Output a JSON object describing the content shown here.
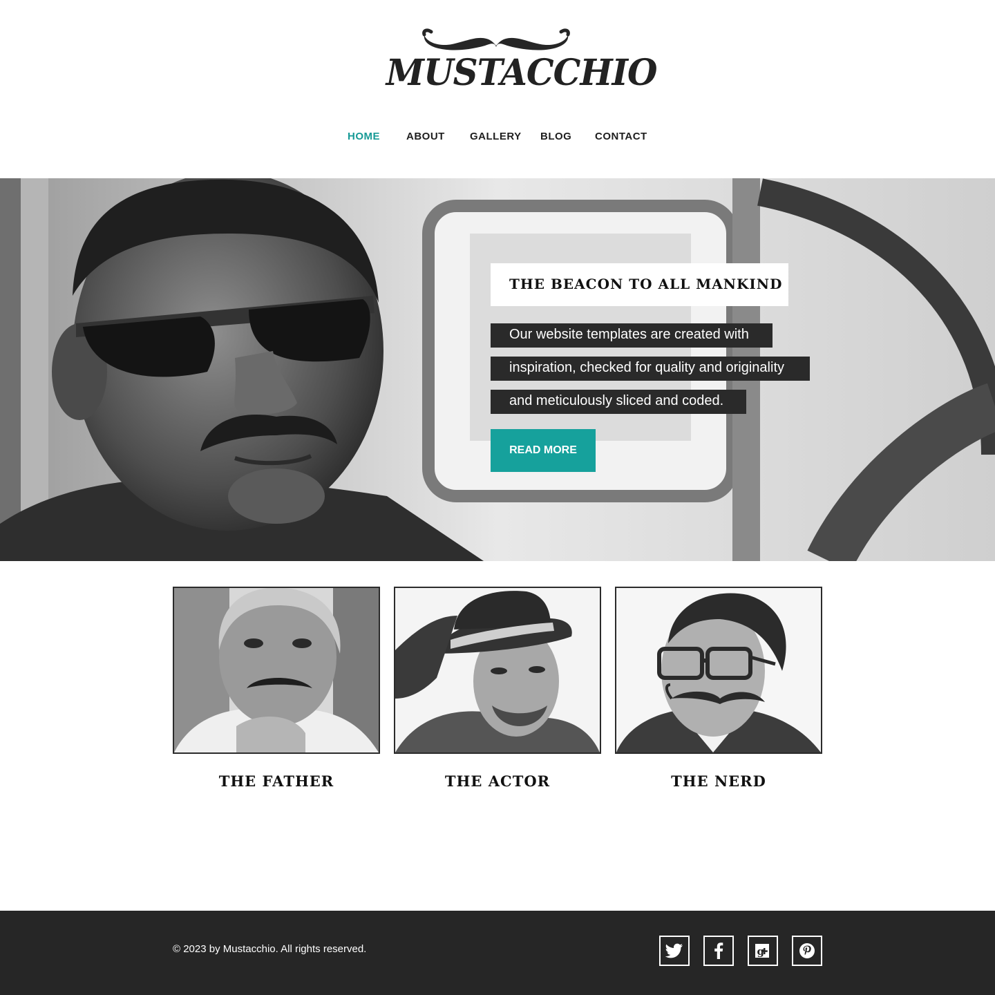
{
  "brand": {
    "name": "MUSTACCHIO"
  },
  "nav": {
    "items": [
      {
        "label": "HOME",
        "active": true
      },
      {
        "label": "ABOUT",
        "active": false
      },
      {
        "label": "GALLERY",
        "active": false
      },
      {
        "label": "BLOG",
        "active": false
      },
      {
        "label": "CONTACT",
        "active": false
      }
    ]
  },
  "hero": {
    "title": "THE BEACON TO ALL MANKIND",
    "lines": [
      "Our website templates are created with",
      "inspiration, checked for quality and originality",
      "and meticulously sliced and coded."
    ],
    "button_label": "READ MORE"
  },
  "profiles": [
    {
      "title": "THE FATHER"
    },
    {
      "title": "THE ACTOR"
    },
    {
      "title": "THE NERD"
    }
  ],
  "footer": {
    "copyright": "© 2023 by Mustacchio. All rights reserved.",
    "social": [
      "twitter-icon",
      "facebook-icon",
      "google-plus-icon",
      "pinterest-icon"
    ]
  },
  "colors": {
    "accent": "#169a96",
    "button": "#16a19c",
    "footer_bg": "#262626",
    "text_dark": "#1e1e1e"
  }
}
